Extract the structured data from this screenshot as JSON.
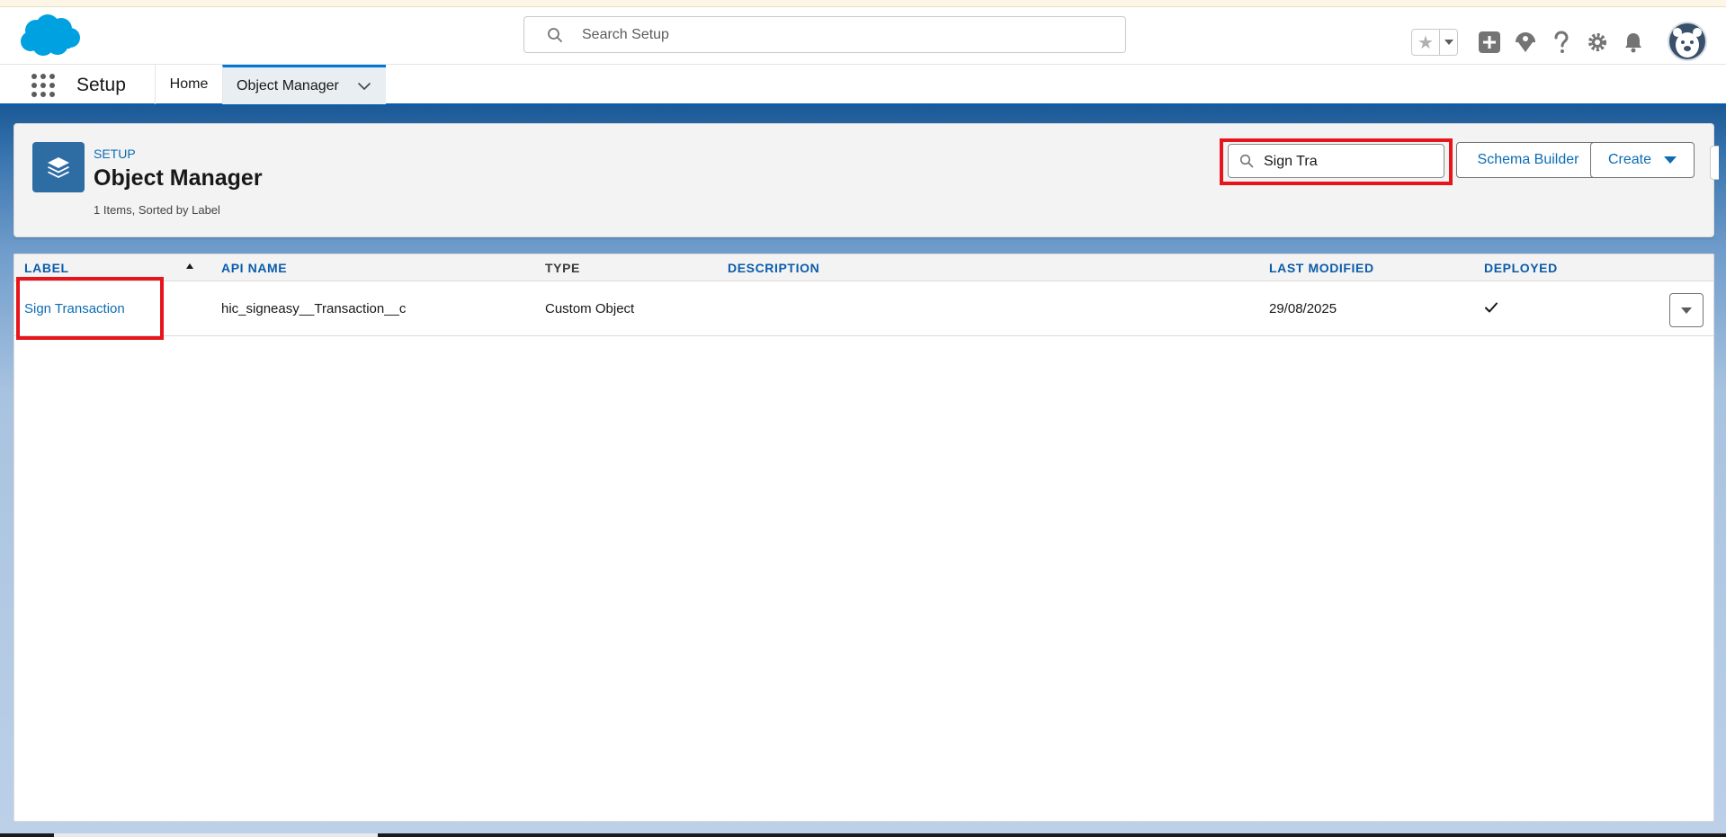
{
  "global_header": {
    "search_placeholder": "Search Setup"
  },
  "context_nav": {
    "app_name": "Setup",
    "tabs": [
      {
        "label": "Home"
      },
      {
        "label": "Object Manager"
      }
    ]
  },
  "page_header": {
    "eyebrow": "SETUP",
    "title": "Object Manager",
    "meta": "1 Items, Sorted by Label",
    "quick_find_value": "Sign Tra",
    "schema_builder_label": "Schema Builder",
    "create_label": "Create"
  },
  "table": {
    "columns": [
      "LABEL",
      "API NAME",
      "TYPE",
      "DESCRIPTION",
      "LAST MODIFIED",
      "DEPLOYED"
    ],
    "sorted_by": "LABEL",
    "sort_direction": "ascending",
    "rows": [
      {
        "label": "Sign Transaction",
        "api_name": "hic_signeasy__Transaction__c",
        "type": "Custom Object",
        "description": "",
        "last_modified": "29/08/2025",
        "deployed": true
      }
    ]
  },
  "colors": {
    "brand_blue": "#0176d3",
    "link_blue": "#0b6cb3",
    "highlight_red": "#e8141c",
    "header_band": "#1b5a97"
  },
  "icons": [
    "salesforce-cloud-logo",
    "search-icon",
    "star-icon",
    "caret-down-icon",
    "add-icon",
    "trailhead-icon",
    "help-icon",
    "gear-icon",
    "bell-icon",
    "avatar",
    "app-launcher-icon",
    "chevron-down-icon",
    "layers-icon",
    "checkmark-icon"
  ]
}
